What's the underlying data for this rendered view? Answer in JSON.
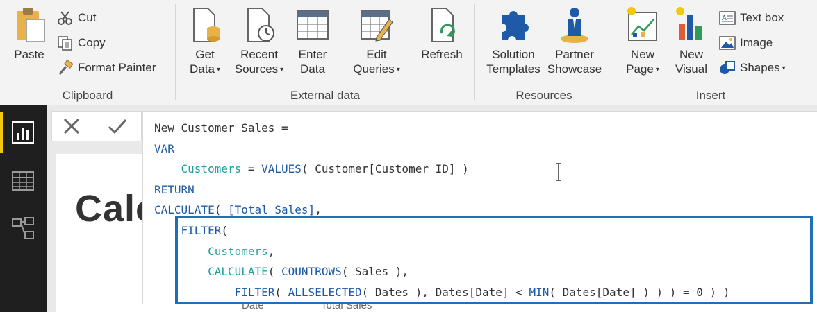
{
  "ribbon": {
    "clipboard": {
      "label": "Clipboard",
      "paste": "Paste",
      "cut": "Cut",
      "copy": "Copy",
      "format_painter": "Format Painter"
    },
    "external_data": {
      "label": "External data",
      "get_data": [
        "Get",
        "Data"
      ],
      "recent_sources": [
        "Recent",
        "Sources"
      ],
      "enter_data": [
        "Enter",
        "Data"
      ],
      "edit_queries": [
        "Edit",
        "Queries"
      ],
      "refresh": "Refresh"
    },
    "resources": {
      "label": "Resources",
      "solution_templates": [
        "Solution",
        "Templates"
      ],
      "partner_showcase": [
        "Partner",
        "Showcase"
      ]
    },
    "insert": {
      "label": "Insert",
      "new_page": [
        "New",
        "Page"
      ],
      "new_visual": [
        "New",
        "Visual"
      ],
      "text_box": "Text box",
      "image": "Image",
      "shapes": "Shapes"
    },
    "caret": "▾"
  },
  "formula_bar": {
    "cancel_symbol": "✕",
    "commit_symbol": "✓",
    "lines": [
      [
        {
          "t": "New Customer Sales =",
          "c": "txt"
        }
      ],
      [
        {
          "t": "VAR",
          "c": "kw"
        }
      ],
      [
        {
          "t": "    ",
          "c": "txt"
        },
        {
          "t": "Customers",
          "c": "var"
        },
        {
          "t": " = ",
          "c": "txt"
        },
        {
          "t": "VALUES",
          "c": "kw"
        },
        {
          "t": "( Customer[Customer ID] )",
          "c": "txt"
        }
      ],
      [
        {
          "t": "RETURN",
          "c": "kw"
        }
      ],
      [
        {
          "t": "CALCULATE",
          "c": "kw"
        },
        {
          "t": "( ",
          "c": "txt"
        },
        {
          "t": "[Total Sales]",
          "c": "kw"
        },
        {
          "t": ",",
          "c": "txt"
        }
      ],
      [
        {
          "t": "    ",
          "c": "txt"
        },
        {
          "t": "FILTER",
          "c": "kw"
        },
        {
          "t": "(",
          "c": "txt"
        }
      ],
      [
        {
          "t": "        ",
          "c": "txt"
        },
        {
          "t": "Customers",
          "c": "var"
        },
        {
          "t": ",",
          "c": "txt"
        }
      ],
      [
        {
          "t": "        ",
          "c": "txt"
        },
        {
          "t": "CALCULATE",
          "c": "var"
        },
        {
          "t": "( ",
          "c": "txt"
        },
        {
          "t": "COUNTROWS",
          "c": "kw"
        },
        {
          "t": "( Sales ),",
          "c": "txt"
        }
      ],
      [
        {
          "t": "            ",
          "c": "txt"
        },
        {
          "t": "FILTER",
          "c": "kw"
        },
        {
          "t": "( ",
          "c": "txt"
        },
        {
          "t": "ALLSELECTED",
          "c": "kw"
        },
        {
          "t": "( Dates ), Dates[Date] < ",
          "c": "txt"
        },
        {
          "t": "MIN",
          "c": "kw"
        },
        {
          "t": "( Dates[Date] ) ) ) = 0 ) )",
          "c": "txt"
        }
      ]
    ]
  },
  "canvas": {
    "title_partial": "Calc",
    "column_date": "Date",
    "column_total_sales": "Total Sales"
  },
  "colors": {
    "accent_yellow": "#f2c811",
    "highlight_blue": "#1f6fb8",
    "keyword_blue": "#1e5aa8",
    "variable_teal": "#20a0a0"
  }
}
